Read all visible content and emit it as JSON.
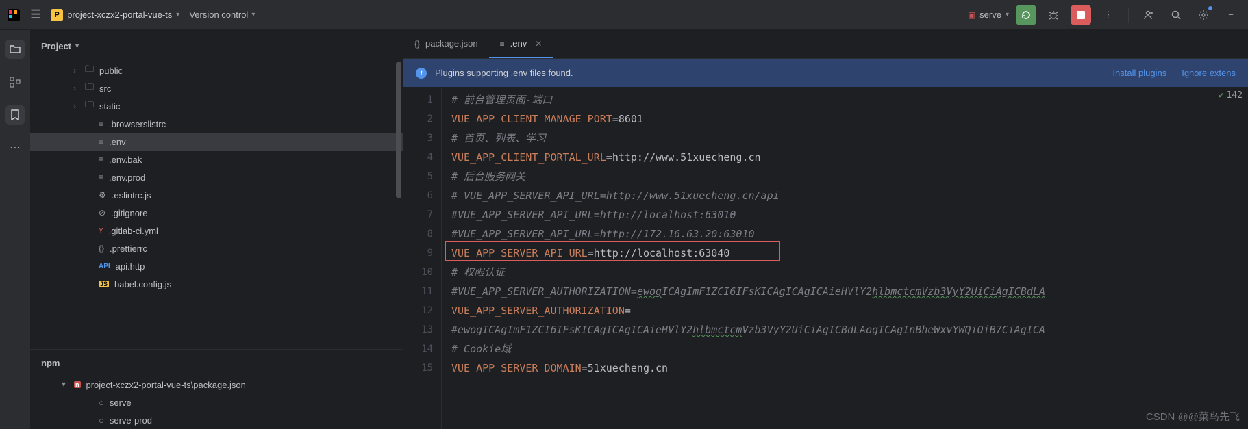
{
  "top": {
    "project_letter": "P",
    "project_name": "project-xczx2-portal-vue-ts",
    "vc_label": "Version control"
  },
  "run": {
    "config_name": "serve"
  },
  "project_panel": {
    "title": "Project",
    "tree": [
      {
        "name": "public",
        "type": "folder"
      },
      {
        "name": "src",
        "type": "folder"
      },
      {
        "name": "static",
        "type": "folder"
      },
      {
        "name": ".browserslistrc",
        "type": "file"
      },
      {
        "name": ".env",
        "type": "file",
        "selected": true
      },
      {
        "name": ".env.bak",
        "type": "file"
      },
      {
        "name": ".env.prod",
        "type": "file"
      },
      {
        "name": ".eslintrc.js",
        "type": "file",
        "icon": "gear"
      },
      {
        "name": ".gitignore",
        "type": "file",
        "icon": "ignore"
      },
      {
        "name": ".gitlab-ci.yml",
        "type": "file",
        "icon": "yml"
      },
      {
        "name": ".prettierrc",
        "type": "file",
        "icon": "brace"
      },
      {
        "name": "api.http",
        "type": "file",
        "icon": "api"
      },
      {
        "name": "babel.config.js",
        "type": "file",
        "icon": "js"
      }
    ]
  },
  "npm": {
    "title": "npm",
    "root": "project-xczx2-portal-vue-ts\\package.json",
    "scripts": [
      "serve",
      "serve-prod"
    ]
  },
  "tabs": [
    {
      "label": "package.json",
      "icon": "brace",
      "active": false
    },
    {
      "label": ".env",
      "icon": "text",
      "active": true
    }
  ],
  "notification": {
    "message": "Plugins supporting .env files found.",
    "link_install": "Install plugins",
    "link_ignore": "Ignore extens"
  },
  "inspection_count": "142",
  "code_lines": [
    {
      "n": 1,
      "tokens": [
        {
          "t": "comment",
          "v": "# 前台管理页面-端口"
        }
      ]
    },
    {
      "n": 2,
      "tokens": [
        {
          "t": "key",
          "v": "VUE_APP_CLIENT_MANAGE_PORT"
        },
        {
          "t": "op",
          "v": "="
        },
        {
          "t": "val",
          "v": "8601"
        }
      ]
    },
    {
      "n": 3,
      "tokens": [
        {
          "t": "comment",
          "v": "# 首页、列表、学习"
        }
      ]
    },
    {
      "n": 4,
      "tokens": [
        {
          "t": "key",
          "v": "VUE_APP_CLIENT_PORTAL_URL"
        },
        {
          "t": "op",
          "v": "="
        },
        {
          "t": "val",
          "v": "http://www.51xuecheng.cn"
        }
      ]
    },
    {
      "n": 5,
      "tokens": [
        {
          "t": "comment",
          "v": "# 后台服务网关"
        }
      ]
    },
    {
      "n": 6,
      "tokens": [
        {
          "t": "comment",
          "v": "# VUE_APP_SERVER_API_URL=http://www.51xuecheng.cn/api"
        }
      ]
    },
    {
      "n": 7,
      "tokens": [
        {
          "t": "comment",
          "v": "#VUE_APP_SERVER_API_URL=http://localhost:63010"
        }
      ]
    },
    {
      "n": 8,
      "tokens": [
        {
          "t": "comment",
          "v": "#VUE_APP_SERVER_API_URL=http://172.16.63.20:63010"
        }
      ]
    },
    {
      "n": 9,
      "tokens": [
        {
          "t": "key",
          "v": "VUE_APP_SERVER_API_URL"
        },
        {
          "t": "op",
          "v": "="
        },
        {
          "t": "val",
          "v": "http://localhost:63040"
        }
      ]
    },
    {
      "n": 10,
      "tokens": [
        {
          "t": "comment",
          "v": "# 权限认证"
        }
      ]
    },
    {
      "n": 11,
      "tokens": [
        {
          "t": "comment",
          "v": "#VUE_APP_SERVER_AUTHORIZATION="
        },
        {
          "t": "comment-wavy",
          "v": "ewog"
        },
        {
          "t": "comment",
          "v": "ICAgImF1ZCI6IFsKICAgICAgICAieHVlY2"
        },
        {
          "t": "comment-wavy",
          "v": "hlbmctcmVzb3VyY2UiCiAgICBdLA"
        }
      ]
    },
    {
      "n": 12,
      "tokens": [
        {
          "t": "key",
          "v": "VUE_APP_SERVER_AUTHORIZATION"
        },
        {
          "t": "op",
          "v": "="
        }
      ]
    },
    {
      "n": 13,
      "tokens": [
        {
          "t": "comment",
          "v": "#ewogICAgImF1ZCI6IFsKICAgICAgICAieHVlY2"
        },
        {
          "t": "comment-wavy",
          "v": "hlbmctcm"
        },
        {
          "t": "comment",
          "v": "Vzb3VyY2UiCiAgICBdLAogICAgInBheWxvYWQiOiB7CiAgICA"
        }
      ]
    },
    {
      "n": 14,
      "tokens": [
        {
          "t": "comment",
          "v": "# Cookie域"
        }
      ]
    },
    {
      "n": 15,
      "tokens": [
        {
          "t": "key",
          "v": "VUE_APP_SERVER_DOMAIN"
        },
        {
          "t": "op",
          "v": "="
        },
        {
          "t": "val",
          "v": "51xuecheng.cn"
        }
      ]
    }
  ],
  "watermark": "CSDN @@菜鸟先飞"
}
